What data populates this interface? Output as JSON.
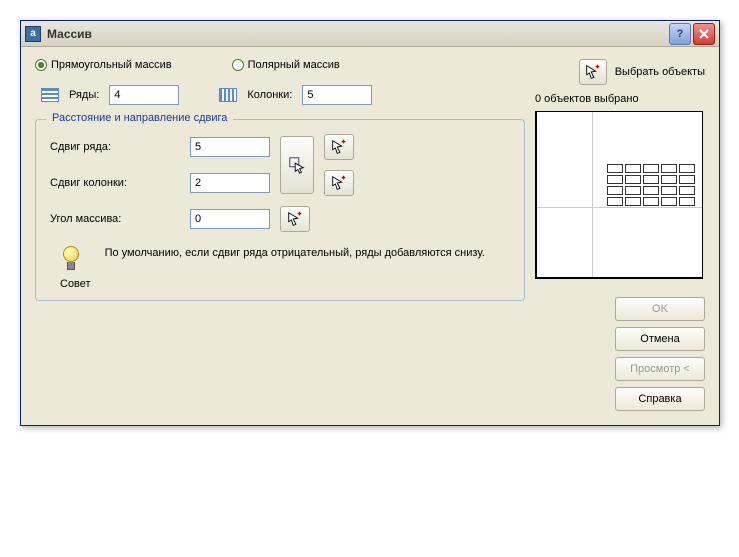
{
  "window": {
    "title": "Массив"
  },
  "array_type": {
    "rectangular": "Прямоугольный массив",
    "polar": "Полярный массив",
    "selected": "rectangular"
  },
  "rows": {
    "label": "Ряды:",
    "value": "4"
  },
  "cols": {
    "label": "Колонки:",
    "value": "5"
  },
  "fieldset": {
    "legend": "Расстояние и направление сдвига"
  },
  "offset": {
    "row": {
      "label": "Сдвиг ряда:",
      "value": "5"
    },
    "column": {
      "label": "Сдвиг колонки:",
      "value": "2"
    },
    "angle": {
      "label": "Угол массива:",
      "value": "0"
    }
  },
  "tip": {
    "heading": "Совет",
    "text": "По умолчанию, если сдвиг ряда отрицательный, ряды добавляются снизу."
  },
  "select": {
    "button_title": "Выбрать объекты",
    "label": "Выбрать объекты"
  },
  "status": "0 объектов выбрано",
  "buttons": {
    "ok": "OK",
    "cancel": "Отмена",
    "preview": "Просмотр <",
    "help": "Справка"
  }
}
